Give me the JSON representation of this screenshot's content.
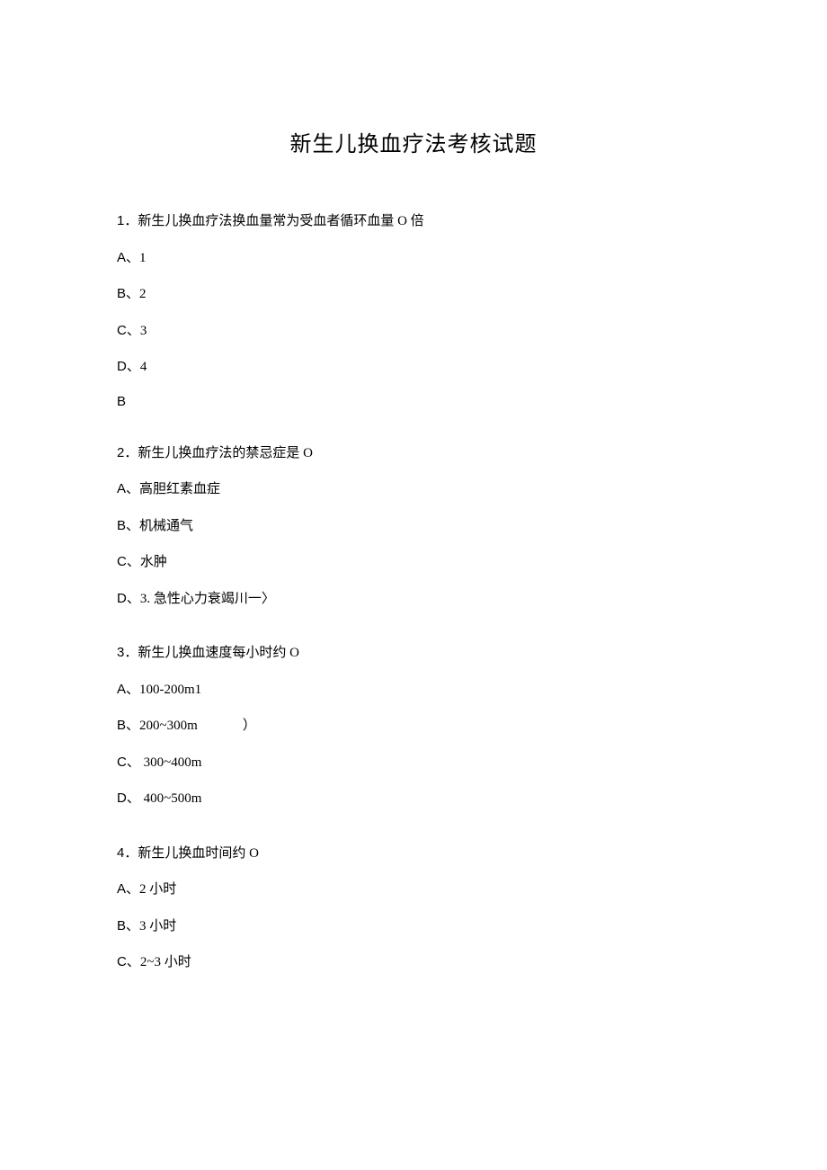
{
  "title": "新生儿换血疗法考核试题",
  "questions": [
    {
      "num": "1",
      "text": "．新生儿换血疗法换血量常为受血者循环血量 O 倍",
      "options": [
        {
          "label": "A、",
          "text": "1"
        },
        {
          "label": "B、",
          "text": "2"
        },
        {
          "label": "C、",
          "text": "3"
        },
        {
          "label": "D、",
          "text": "4"
        }
      ],
      "answer": "B"
    },
    {
      "num": "2",
      "text": "．新生儿换血疗法的禁忌症是 O",
      "options": [
        {
          "label": "A、",
          "text": "高胆红素血症"
        },
        {
          "label": "B、",
          "text": "机械通气"
        },
        {
          "label": "C、",
          "text": "水肿"
        },
        {
          "label": "D、",
          "text": "3. 急性心力衰竭川一〉"
        }
      ]
    },
    {
      "num": "3",
      "text": "．新生儿换血速度每小时约 O",
      "options": [
        {
          "label": "A、",
          "text": "100-200m1"
        },
        {
          "label": "B、",
          "text": "200~300m",
          "paren": "）"
        },
        {
          "label": "C、",
          "text": " 300~400m"
        },
        {
          "label": "D、",
          "text": " 400~500m"
        }
      ]
    },
    {
      "num": "4",
      "text": "．新生儿换血时间约 O",
      "options": [
        {
          "label": "A、",
          "text": "2 小时"
        },
        {
          "label": "B、",
          "text": "3 小时"
        },
        {
          "label": "C、",
          "text": "2~3 小时"
        }
      ]
    }
  ]
}
